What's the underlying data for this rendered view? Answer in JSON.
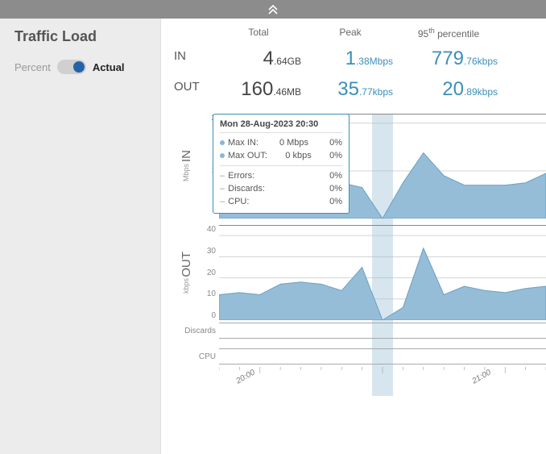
{
  "header": {
    "collapse_icon": "⌃⌃"
  },
  "sidebar": {
    "title": "Traffic Load",
    "toggle": {
      "left": "Percent",
      "right": "Actual"
    }
  },
  "stats": {
    "head_total": "Total",
    "head_peak": "Peak",
    "head_pct": "95ᵗʰ percentile",
    "in_label": "IN",
    "out_label": "OUT",
    "in_total_big": "4",
    "in_total_small": ".64",
    "in_total_unit": "GB",
    "in_peak_big": "1",
    "in_peak_small": ".38",
    "in_peak_unit": "Mbps",
    "in_pct_big": "779",
    "in_pct_small": ".76",
    "in_pct_unit": "kbps",
    "out_total_big": "160",
    "out_total_small": ".46",
    "out_total_unit": "MB",
    "out_peak_big": "35",
    "out_peak_small": ".77",
    "out_peak_unit": "kbps",
    "out_pct_big": "20",
    "out_pct_small": ".89",
    "out_pct_unit": "kbps"
  },
  "tooltip": {
    "title": "Mon 28-Aug-2023 20:30",
    "max_in_label": "Max IN:",
    "max_in_val": "0 Mbps",
    "max_in_pct": "0%",
    "max_out_label": "Max OUT:",
    "max_out_val": "0 kbps",
    "max_out_pct": "0%",
    "errors_label": "Errors:",
    "errors_val": "0%",
    "discards_label": "Discards:",
    "discards_val": "0%",
    "cpu_label": "CPU:",
    "cpu_val": "0%"
  },
  "charts": {
    "in": {
      "label": "IN",
      "unit": "Mbps",
      "ticks": [
        "2",
        "1"
      ]
    },
    "out": {
      "label": "OUT",
      "unit": "kbps",
      "ticks": [
        "40",
        "30",
        "20",
        "10",
        "0"
      ]
    },
    "discards_label": "Discards",
    "cpu_label": "CPU",
    "xticks": [
      {
        "label": "20:00",
        "pct": 8
      },
      {
        "label": "21:00",
        "pct": 80
      }
    ]
  },
  "chart_data": [
    {
      "type": "area",
      "title": "IN",
      "ylabel": "Mbps",
      "ylim": [
        0,
        2.2
      ],
      "series": [
        {
          "name": "Max IN",
          "x": [
            "19:50",
            "19:55",
            "20:00",
            "20:05",
            "20:10",
            "20:15",
            "20:20",
            "20:25",
            "20:30",
            "20:35",
            "20:40",
            "20:45",
            "20:50",
            "20:55",
            "21:00",
            "21:05",
            "21:10"
          ],
          "values": [
            0.75,
            0.75,
            0.8,
            0.85,
            0.8,
            0.8,
            0.75,
            0.65,
            0,
            0.75,
            1.38,
            0.9,
            0.7,
            0.7,
            0.7,
            0.75,
            0.95
          ]
        }
      ]
    },
    {
      "type": "area",
      "title": "OUT",
      "ylabel": "kbps",
      "ylim": [
        0,
        45
      ],
      "series": [
        {
          "name": "Max OUT",
          "x": [
            "19:50",
            "19:55",
            "20:00",
            "20:05",
            "20:10",
            "20:15",
            "20:20",
            "20:25",
            "20:30",
            "20:35",
            "20:40",
            "20:45",
            "20:50",
            "20:55",
            "21:00",
            "21:05",
            "21:10"
          ],
          "values": [
            12,
            13,
            12,
            17,
            18,
            17,
            14,
            25,
            0,
            6,
            34,
            12,
            16,
            14,
            13,
            15,
            16
          ]
        }
      ]
    },
    {
      "type": "line",
      "title": "Discards",
      "series": [
        {
          "name": "Discards",
          "values": []
        }
      ]
    },
    {
      "type": "line",
      "title": "CPU",
      "series": [
        {
          "name": "CPU",
          "values": []
        }
      ]
    }
  ]
}
